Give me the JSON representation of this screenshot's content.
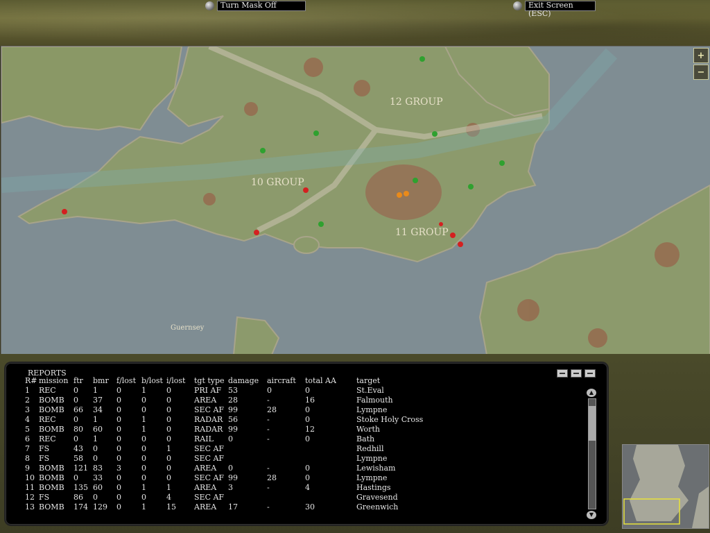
{
  "topbar": {
    "mask_button": "Turn Mask Off",
    "exit_button": "Exit Screen (ESC)"
  },
  "map": {
    "labels": {
      "group12": "12 GROUP",
      "group10": "10 GROUP",
      "group11": "11 GROUP",
      "guernsey": "Guernsey"
    },
    "zoom_in": "+",
    "zoom_out": "−",
    "colors": {
      "sea": "#7f8d93",
      "land": "#8a9a6a",
      "friendly": "#2fa12f",
      "hostile": "#d42020",
      "target": "#e98a1a"
    }
  },
  "reports": {
    "title": "REPORTS",
    "headers": [
      "R#",
      "mission",
      "ftr",
      "bmr",
      "f/lost",
      "b/lost",
      "i/lost",
      "tgt type",
      "damage",
      "aircraft",
      "total AA",
      "target"
    ],
    "rows": [
      [
        "1",
        "REC",
        "0",
        "1",
        "0",
        "1",
        "0",
        "PRI AF",
        "53",
        "0",
        "0",
        "St.Eval"
      ],
      [
        "2",
        "BOMB",
        "0",
        "37",
        "0",
        "0",
        "0",
        "AREA",
        "28",
        "-",
        "16",
        "Falmouth"
      ],
      [
        "3",
        "BOMB",
        "66",
        "34",
        "0",
        "0",
        "0",
        "SEC AF",
        "99",
        "28",
        "0",
        "Lympne"
      ],
      [
        "4",
        "REC",
        "0",
        "1",
        "0",
        "1",
        "0",
        "RADAR",
        "56",
        "-",
        "0",
        "Stoke Holy Cross"
      ],
      [
        "5",
        "BOMB",
        "80",
        "60",
        "0",
        "1",
        "0",
        "RADAR",
        "99",
        "-",
        "12",
        "Worth"
      ],
      [
        "6",
        "REC",
        "0",
        "1",
        "0",
        "0",
        "0",
        "RAIL",
        "0",
        "-",
        "0",
        "Bath"
      ],
      [
        "7",
        "FS",
        "43",
        "0",
        "0",
        "0",
        "1",
        "SEC AF",
        "",
        "",
        "",
        "Redhill"
      ],
      [
        "8",
        "FS",
        "58",
        "0",
        "0",
        "0",
        "0",
        "SEC AF",
        "",
        "",
        "",
        "Lympne"
      ],
      [
        "9",
        "BOMB",
        "121",
        "83",
        "3",
        "0",
        "0",
        "AREA",
        "0",
        "-",
        "0",
        "Lewisham"
      ],
      [
        "10",
        "BOMB",
        "0",
        "33",
        "0",
        "0",
        "0",
        "SEC AF",
        "99",
        "28",
        "0",
        "Lympne"
      ],
      [
        "11",
        "BOMB",
        "135",
        "60",
        "0",
        "1",
        "1",
        "AREA",
        "3",
        "-",
        "4",
        "Hastings"
      ],
      [
        "12",
        "FS",
        "86",
        "0",
        "0",
        "0",
        "4",
        "SEC AF",
        "",
        "",
        "",
        "Gravesend"
      ],
      [
        "13",
        "BOMB",
        "174",
        "129",
        "0",
        "1",
        "15",
        "AREA",
        "17",
        "-",
        "30",
        "Greenwich"
      ]
    ]
  }
}
